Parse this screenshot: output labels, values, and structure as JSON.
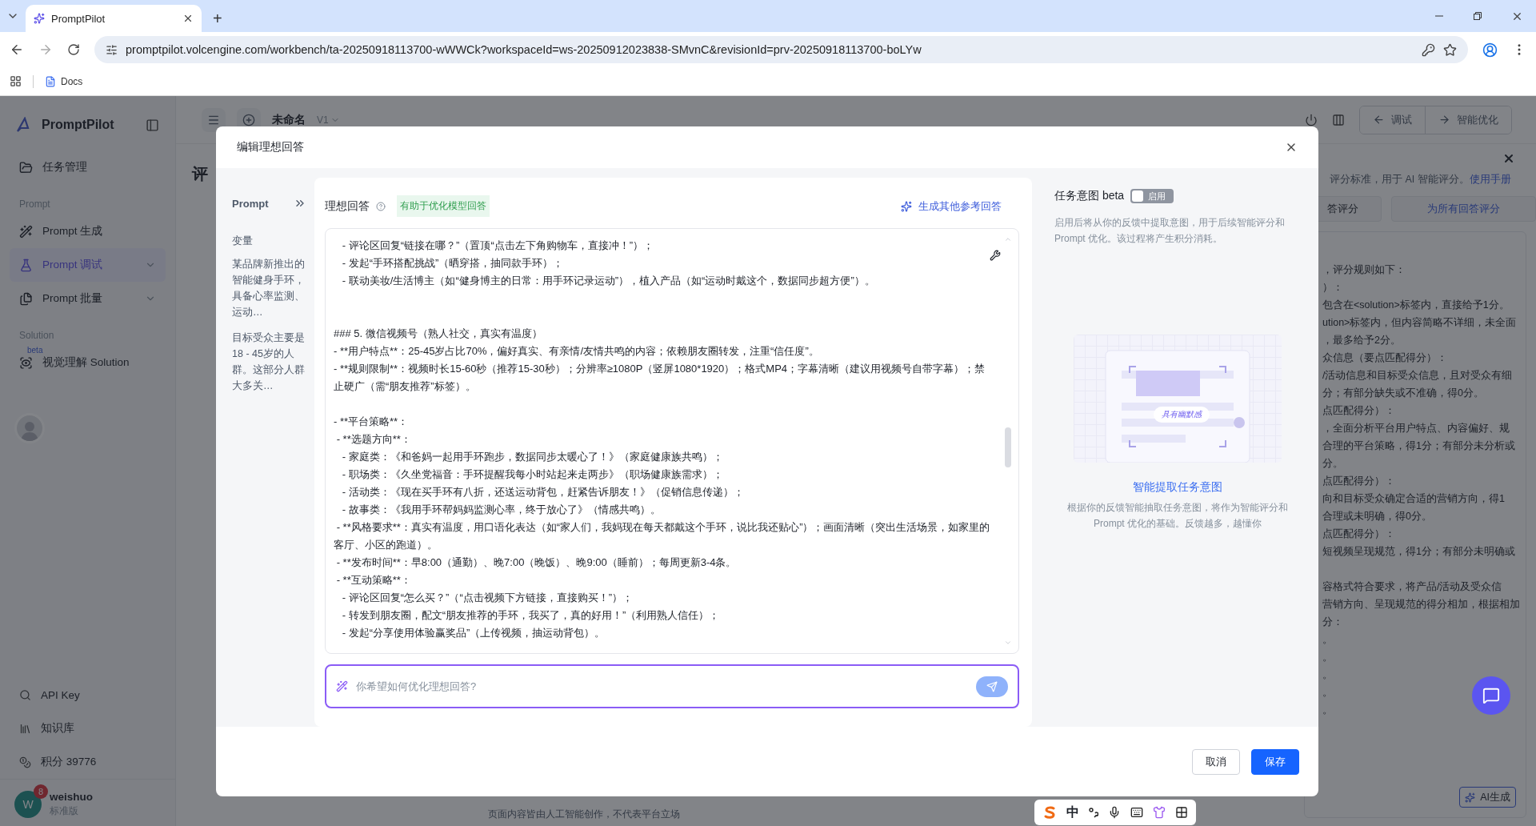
{
  "browser": {
    "tab_title": "PromptPilot",
    "new_tab": "+",
    "url": "promptpilot.volcengine.com/workbench/ta-20250918113700-wWWCk?workspaceId=ws-20250912023838-SMvnC&revisionId=prv-20250918113700-boLYw",
    "bookmarks": [
      "Docs"
    ]
  },
  "sidebar": {
    "brand": "PromptPilot",
    "sections": [
      {
        "items": [
          {
            "label": "任务管理",
            "selected": false,
            "expandable": false
          }
        ]
      },
      {
        "title": "Prompt",
        "items": [
          {
            "label": "Prompt 生成",
            "selected": false,
            "expandable": false
          },
          {
            "label": "Prompt 调试",
            "selected": true,
            "expandable": true
          },
          {
            "label": "Prompt 批量",
            "selected": false,
            "expandable": true
          }
        ]
      },
      {
        "title": "Solution",
        "items": [
          {
            "label": "视觉理解 Solution",
            "badge": "beta",
            "selected": false,
            "expandable": false
          }
        ]
      }
    ],
    "bottom_items": [
      "API Key",
      "知识库",
      "积分 39776"
    ],
    "user": {
      "initial": "W",
      "notifications": "8",
      "name": "weishuo",
      "plan": "标准版"
    }
  },
  "header": {
    "title": "未命名",
    "version": "V1",
    "buttons": [
      "调试",
      "智能优化"
    ]
  },
  "page": {
    "heading": "评",
    "panel": {
      "notice": "评分标准，用于 AI 智能评分。",
      "notice_link": "使用手册",
      "buttons": [
        "答评分",
        "为所有回答评分"
      ],
      "rules": [
        {
          "kind": "text",
          "text": "，评分规则如下："
        },
        {
          "kind": "text",
          "text": "）："
        },
        {
          "kind": "text",
          "text": "包含在<solution>标签内，直接给予1分。"
        },
        {
          "kind": "text",
          "text": "ution>标签内，但内容简略不详细，未全面"
        },
        {
          "kind": "text",
          "text": "，最多给予2分。"
        },
        {
          "kind": "text",
          "text": "众信息（要点匹配得分）："
        },
        {
          "kind": "text",
          "text": "/活动信息和目标受众信息，且对受众有细"
        },
        {
          "kind": "text",
          "text": "分；有部分缺失或不准确，得0分。"
        },
        {
          "kind": "text",
          "text": "点匹配得分）："
        },
        {
          "kind": "text",
          "text": "，全面分析平台用户特点、内容偏好、规"
        },
        {
          "kind": "text",
          "text": "合理的平台策略，得1分；有部分未分析或"
        },
        {
          "kind": "text",
          "text": "分。"
        },
        {
          "kind": "text",
          "text": "点匹配得分）："
        },
        {
          "kind": "text",
          "text": "向和目标受众确定合适的营销方向，得1"
        },
        {
          "kind": "text",
          "text": "合理或未明确，得0分。"
        },
        {
          "kind": "text",
          "text": "点匹配得分）："
        },
        {
          "kind": "text",
          "text": "短视频呈现规范，得1分；有部分未明确或"
        },
        {
          "kind": "blank"
        },
        {
          "kind": "text",
          "text": "容格式符合要求，将产品/活动及受众信"
        },
        {
          "kind": "text",
          "text": "营销方向、呈现规范的得分相加，根据相加"
        },
        {
          "kind": "text",
          "text": "分："
        },
        {
          "kind": "text",
          "text": "。"
        },
        {
          "kind": "text",
          "text": "。"
        },
        {
          "kind": "text",
          "text": "。"
        },
        {
          "kind": "text",
          "text": "。"
        },
        {
          "kind": "text",
          "text": "。"
        }
      ],
      "ai_button": "AI生成"
    },
    "footer_note": "页面内容皆由人工智能创作，不代表平台立场"
  },
  "modal": {
    "title": "编辑理想回答",
    "left": {
      "prompt_label": "Prompt",
      "variables_title": "变量",
      "variables": [
        "某品牌新推出的智能健身手环，具备心率监测、运动…",
        "目标受众主要是18 - 45岁的人群。这部分人群大多关…"
      ]
    },
    "answer": {
      "title": "理想回答",
      "tag": "有助于优化模型回答",
      "generate": "生成其他参考回答",
      "lines": [
        {
          "kind": "text",
          "text": "   - 评论区回复“链接在哪？”（置顶“点击左下角购物车，直接冲！”）；"
        },
        {
          "kind": "text",
          "text": "   - 发起“手环搭配挑战”（晒穿搭，抽同款手环）；"
        },
        {
          "kind": "text",
          "text": "   - 联动美妆/生活博主（如“健身博主的日常：用手环记录运动”），植入产品（如“运动时戴这个，数据同步超方便”）。"
        },
        {
          "kind": "blank"
        },
        {
          "kind": "blank"
        },
        {
          "kind": "text",
          "text": "### 5. 微信视频号（熟人社交，真实有温度）"
        },
        {
          "kind": "text",
          "text": "- **用户特点**：25-45岁占比70%，偏好真实、有亲情/友情共鸣的内容；依赖朋友圈转发，注重“信任度”。"
        },
        {
          "kind": "text",
          "text": "- **规则限制**：视频时长15-60秒（推荐15-30秒）；分辨率≥1080P（竖屏1080*1920）；格式MP4；字幕清晰（建议用视频号自带字幕）；禁止硬广（需“朋友推荐”标签）。"
        },
        {
          "kind": "blank"
        },
        {
          "kind": "text",
          "text": "- **平台策略**："
        },
        {
          "kind": "text",
          "text": " - **选题方向**："
        },
        {
          "kind": "text",
          "text": "   - 家庭类：《和爸妈一起用手环跑步，数据同步太暖心了！》（家庭健康族共鸣）；"
        },
        {
          "kind": "text",
          "text": "   - 职场类：《久坐党福音：手环提醒我每小时站起来走两步》（职场健康族需求）；"
        },
        {
          "kind": "text",
          "text": "   - 活动类：《现在买手环有八折，还送运动背包，赶紧告诉朋友！》（促销信息传递）；"
        },
        {
          "kind": "text",
          "text": "   - 故事类：《我用手环帮妈妈监测心率，终于放心了》（情感共鸣）。"
        },
        {
          "kind": "text",
          "text": " - **风格要求**：真实有温度，用口语化表达（如“家人们，我妈现在每天都戴这个手环，说比我还贴心”）；画面清晰（突出生活场景，如家里的客厅、小区的跑道）。"
        },
        {
          "kind": "text",
          "text": " - **发布时间**：早8:00（通勤）、晚7:00（晚饭）、晚9:00（睡前）；每周更新3-4条。"
        },
        {
          "kind": "text",
          "text": " - **互动策略**："
        },
        {
          "kind": "text",
          "text": "   - 评论区回复“怎么买？”（“点击视频下方链接，直接购买！”）；"
        },
        {
          "kind": "text",
          "text": "   - 转发到朋友圈，配文“朋友推荐的手环，我买了，真的好用！”（利用熟人信任）；"
        },
        {
          "kind": "text",
          "text": "   - 发起“分享使用体验赢奖品”（上传视频，抽运动背包）。"
        }
      ],
      "input": {
        "placeholder": "你希望如何优化理想回答?"
      }
    },
    "intent": {
      "title": "任务意图 beta",
      "toggle": {
        "label": "启用",
        "on": false
      },
      "description": "启用后将从你的反馈中提取意图，用于后续智能评分和Prompt 优化。该过程将产生积分消耗。",
      "illustration_tag": "具有幽默感",
      "feature_title": "智能提取任务意图",
      "feature_description": "根据你的反馈智能抽取任务意图，将作为智能评分和Prompt 优化的基础。反馈越多，越懂你"
    },
    "buttons": [
      {
        "label": "取消",
        "kind": "secondary"
      },
      {
        "label": "保存",
        "kind": "primary"
      }
    ]
  },
  "ime": {
    "label": "中"
  }
}
